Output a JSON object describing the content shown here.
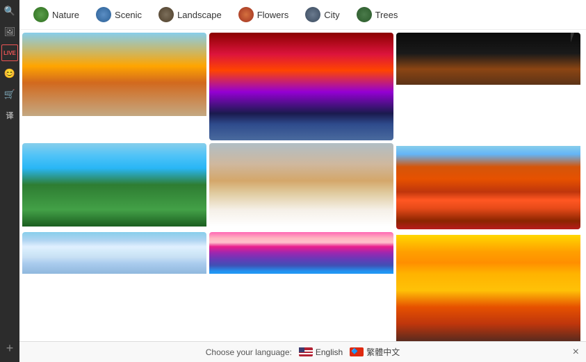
{
  "sidebar": {
    "icons": [
      {
        "name": "search",
        "symbol": "🔍",
        "label": "search-icon"
      },
      {
        "name": "photo",
        "symbol": "🖼",
        "label": "photo-icon"
      },
      {
        "name": "live",
        "symbol": "LIVE",
        "label": "live-icon"
      },
      {
        "name": "smiley",
        "symbol": "😊",
        "label": "smiley-icon"
      },
      {
        "name": "cart",
        "symbol": "🛒",
        "label": "cart-icon"
      },
      {
        "name": "translate",
        "symbol": "译",
        "label": "translate-icon"
      },
      {
        "name": "add",
        "symbol": "+",
        "label": "add-icon"
      }
    ]
  },
  "tabs": [
    {
      "id": "nature",
      "label": "Nature",
      "iconClass": "nature"
    },
    {
      "id": "scenic",
      "label": "Scenic",
      "iconClass": "scenic"
    },
    {
      "id": "landscape",
      "label": "Landscape",
      "iconClass": "landscape"
    },
    {
      "id": "flowers",
      "label": "Flowers",
      "iconClass": "flowers"
    },
    {
      "id": "city",
      "label": "City",
      "iconClass": "city"
    },
    {
      "id": "trees",
      "label": "Trees",
      "iconClass": "trees"
    }
  ],
  "images": [
    {
      "id": 1,
      "alt": "Beach sunset",
      "class": "img-1"
    },
    {
      "id": 2,
      "alt": "Red sky lake reflection",
      "class": "img-2"
    },
    {
      "id": 3,
      "alt": "Dark night desert",
      "class": "img-3"
    },
    {
      "id": 4,
      "alt": "Tropical waterfall",
      "class": "img-4"
    },
    {
      "id": 5,
      "alt": "Rocky beach long exposure",
      "class": "img-5"
    },
    {
      "id": 6,
      "alt": "Autumn forest",
      "class": "img-6"
    },
    {
      "id": 7,
      "alt": "Cloudy sky",
      "class": "img-7"
    },
    {
      "id": 8,
      "alt": "Pink sunset clouds",
      "class": "img-8"
    },
    {
      "id": 9,
      "alt": "Sunlit golden trees",
      "class": "img-9"
    }
  ],
  "lang_bar": {
    "label": "Choose your language:",
    "options": [
      {
        "code": "en",
        "label": "English"
      },
      {
        "code": "zh",
        "label": "繁體中文"
      }
    ],
    "close_label": "×"
  }
}
